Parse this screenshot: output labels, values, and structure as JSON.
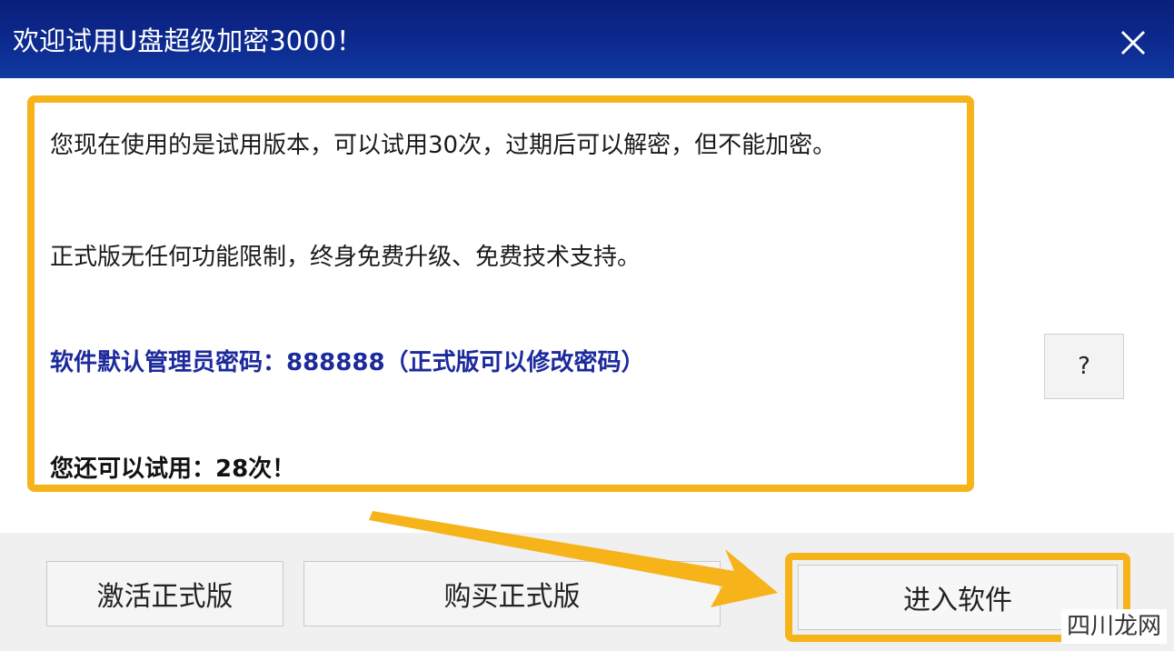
{
  "window": {
    "title": "欢迎试用U盘超级加密3000！",
    "close_icon": "close-icon"
  },
  "messages": {
    "trial_info": "您现在使用的是试用版本，可以试用30次，过期后可以解密，但不能加密。",
    "full_version_info": "正式版无任何功能限制，终身免费升级、免费技术支持。",
    "default_password": "软件默认管理员密码：888888（正式版可以修改密码）",
    "remaining_trials": "您还可以试用：28次！"
  },
  "help_button": {
    "label": "?"
  },
  "buttons": {
    "activate": "激活正式版",
    "buy": "购买正式版",
    "enter": "进入软件"
  },
  "watermark": "四川龙网",
  "colors": {
    "title_bar": "#0d2a8f",
    "highlight": "#f6b31a",
    "password_text": "#1c2a9c"
  }
}
